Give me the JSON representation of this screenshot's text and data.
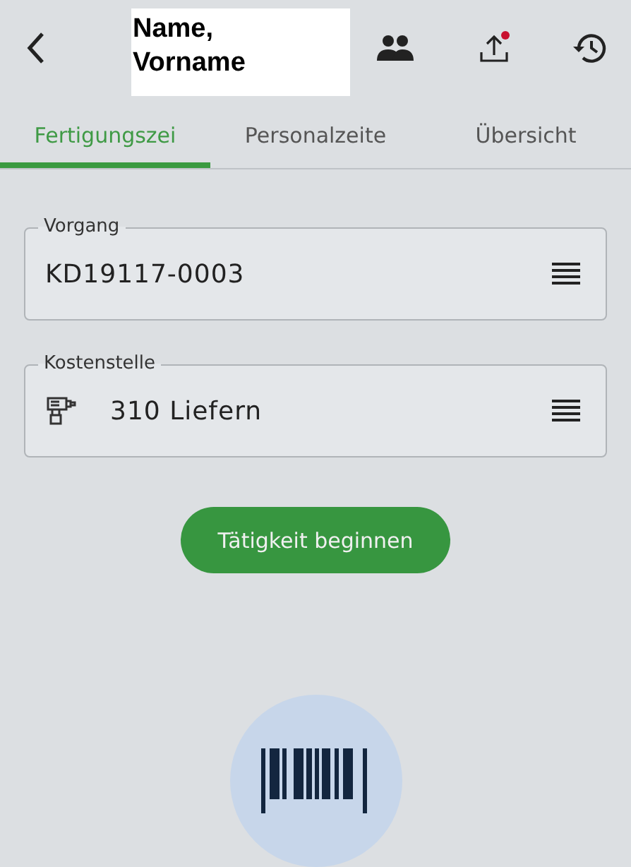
{
  "header": {
    "title": "Name, Vorname",
    "upload_notification": true
  },
  "tabs": [
    {
      "label": "Fertigungszei",
      "selected": true
    },
    {
      "label": "Personalzeite",
      "selected": false
    },
    {
      "label": "Übersicht",
      "selected": false
    }
  ],
  "fields": [
    {
      "label": "Vorgang",
      "value": "KD19117-0003",
      "kind": "plain"
    },
    {
      "label": "Kostenstelle",
      "value": "310 Liefern",
      "kind": "drill"
    }
  ],
  "action_button": "Tätigkeit beginnen"
}
